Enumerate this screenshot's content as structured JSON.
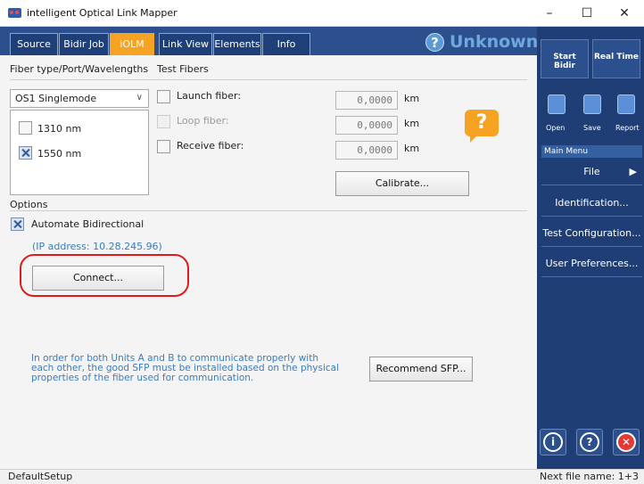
{
  "window": {
    "title": "intelligent Optical Link Mapper",
    "minimize": "–",
    "maximize": "☐",
    "close": "✕"
  },
  "tabs": [
    {
      "label": "Source"
    },
    {
      "label": "Bidir Job"
    },
    {
      "label": "iOLM",
      "active": true
    },
    {
      "label": "Link View"
    },
    {
      "label": "Elements"
    },
    {
      "label": "Info"
    }
  ],
  "status": {
    "icon": "question-circle-icon",
    "symbol": "?",
    "text": "Unknown",
    "color": "#6fa8dc"
  },
  "fiber_section": {
    "heading": "Fiber type/Port/Wavelengths",
    "fiber_type": "OS1 Singlemode",
    "wavelengths": [
      {
        "label": "1310 nm",
        "checked": false
      },
      {
        "label": "1550 nm",
        "checked": true
      }
    ]
  },
  "test_fibers": {
    "heading": "Test Fibers",
    "launch": {
      "label": "Launch fiber:",
      "value": "0,0000",
      "unit": "km",
      "checked": false
    },
    "loop": {
      "label": "Loop fiber:",
      "value": "0,0000",
      "unit": "km",
      "checked": false,
      "disabled": true
    },
    "receive": {
      "label": "Receive fiber:",
      "value": "0,0000",
      "unit": "km",
      "checked": false
    },
    "calibrate": "Calibrate...",
    "help_symbol": "?"
  },
  "options": {
    "heading": "Options",
    "automate_bidir": {
      "label": "Automate Bidirectional",
      "checked": true
    },
    "ip_address": "(IP address: 10.28.245.96)",
    "connect": "Connect...",
    "sfp_info": "In order for both Units A and B to communicate properly with each other, the good SFP must be installed based on the physical properties of the fiber used for communication.",
    "recommend_sfp": "Recommend SFP..."
  },
  "right_panel": {
    "start_bidir": "Start Bidir",
    "real_time": "Real Time",
    "tools": [
      {
        "label": "Open",
        "icon": "folder-open-icon"
      },
      {
        "label": "Save",
        "icon": "floppy-disk-icon"
      },
      {
        "label": "Report",
        "icon": "report-icon"
      }
    ],
    "menu_heading": "Main Menu",
    "menu": [
      {
        "label": "File",
        "arrow": "▶"
      },
      {
        "label": "Identification..."
      },
      {
        "label": "Test Configuration..."
      },
      {
        "label": "User Preferences..."
      }
    ],
    "bottom_buttons": [
      {
        "icon": "info-icon",
        "symbol": "i"
      },
      {
        "icon": "help-icon",
        "symbol": "?"
      },
      {
        "icon": "exit-icon",
        "symbol": "✕"
      }
    ]
  },
  "statusbar": {
    "left": "DefaultSetup",
    "right": "Next file name: 1+3"
  },
  "colors": {
    "accent_orange": "#f6a324",
    "nav_blue": "#2c4f8e",
    "panel_blue": "#1f3e75",
    "link_blue": "#3a7cc0",
    "highlight_red": "#e01b1b"
  }
}
